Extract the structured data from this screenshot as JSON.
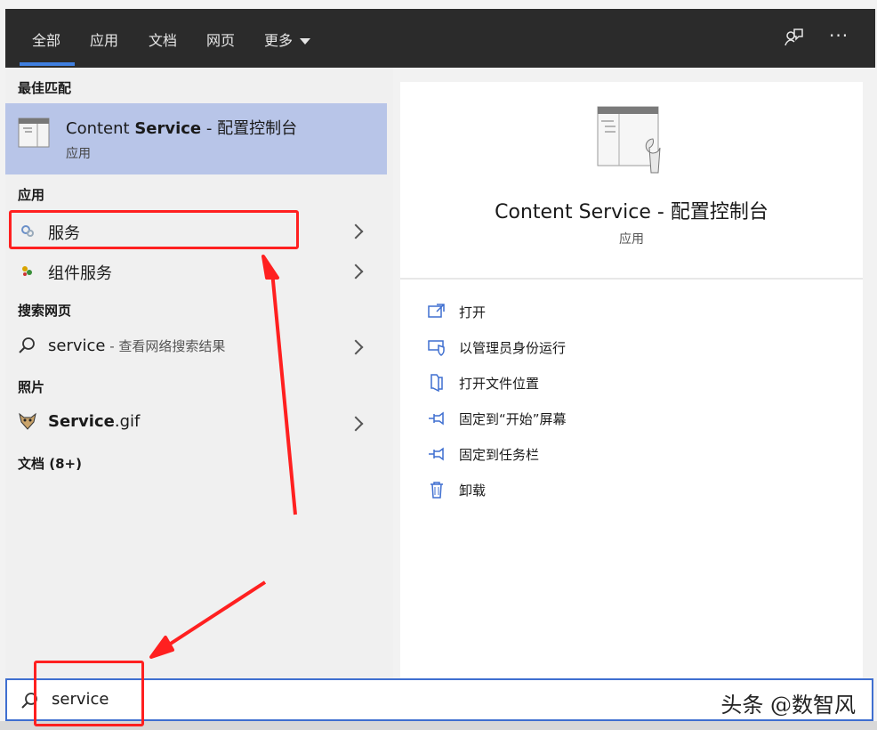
{
  "tabs": [
    "全部",
    "应用",
    "文档",
    "网页"
  ],
  "more_tab": "更多",
  "toolbar": {
    "feedback_icon": "feedback-icon",
    "more_icon": "ellipsis-icon",
    "ellipsis": "···"
  },
  "left": {
    "best_match_heading": "最佳匹配",
    "best_match": {
      "title_prefix": "Content ",
      "title_bold": "Service",
      "title_suffix": " - 配置控制台",
      "subtitle": "应用"
    },
    "apps_heading": "应用",
    "apps": [
      {
        "label": "服务",
        "icon": "services-icon"
      },
      {
        "label": "组件服务",
        "icon": "component-services-icon"
      }
    ],
    "web_heading": "搜索网页",
    "web_item": {
      "query": "service",
      "suffix": " - 查看网络搜索结果"
    },
    "photos_heading": "照片",
    "photo_item": {
      "bold": "Service",
      "rest": ".gif"
    },
    "docs_heading": "文档 (8+)"
  },
  "right": {
    "title": "Content Service - 配置控制台",
    "subtitle": "应用",
    "actions": [
      {
        "label": "打开",
        "icon": "open-icon"
      },
      {
        "label": "以管理员身份运行",
        "icon": "run-as-admin-icon"
      },
      {
        "label": "打开文件位置",
        "icon": "file-location-icon"
      },
      {
        "label": "固定到“开始”屏幕",
        "icon": "pin-icon"
      },
      {
        "label": "固定到任务栏",
        "icon": "pin-icon"
      },
      {
        "label": "卸载",
        "icon": "trash-icon"
      }
    ]
  },
  "search": {
    "value": "service",
    "placeholder": ""
  },
  "watermark": "头条 @数智风",
  "colors": {
    "accent": "#3f7fe0",
    "highlight": "#b8c5e8",
    "annotation": "#ff2020",
    "topbar": "#2b2b2b"
  }
}
